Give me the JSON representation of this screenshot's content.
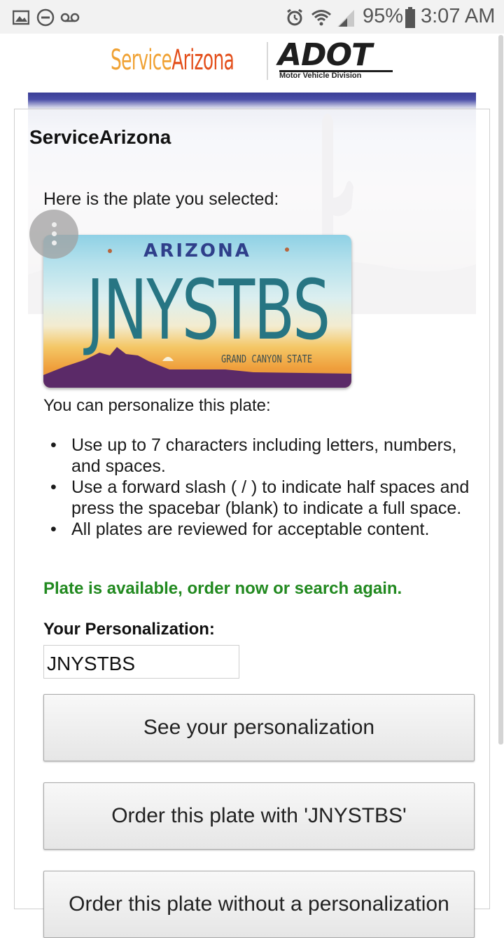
{
  "status_bar": {
    "battery": "95%",
    "time": "3:07 AM",
    "icons": [
      "gallery-icon",
      "do-not-disturb-icon",
      "voicemail-icon",
      "alarm-icon",
      "wifi-icon",
      "signal-icon",
      "battery-icon"
    ]
  },
  "header": {
    "logo_service": "Service",
    "logo_arizona": "Arizona",
    "adot": "ADOT",
    "adot_sub": "Motor Vehicle Division"
  },
  "content": {
    "site_title": "ServiceArizona",
    "intro": "Here is the plate you selected:",
    "plate": {
      "state": "ARIZONA",
      "number": "JNYSTBS",
      "slogan": "GRAND CANYON STATE"
    },
    "personalize_text": "You can personalize this plate:",
    "rules": [
      "Use up to 7 characters including letters, numbers, and spaces.",
      "Use a forward slash ( / ) to indicate half spaces and press the spacebar (blank) to indicate a full space.",
      "All plates are reviewed for acceptable content."
    ],
    "availability": "Plate is available, order now or search again.",
    "your_personalization_label": "Your Personalization:",
    "personalization_value": "JNYSTBS",
    "buttons": {
      "see": "See your personalization",
      "order_with": "Order this plate with 'JNYSTBS'",
      "order_without": "Order this plate without a personalization"
    }
  },
  "colors": {
    "available_green": "#21891f",
    "logo_orange": "#f0a234",
    "logo_red": "#e34e1a",
    "plate_text": "#277583"
  }
}
